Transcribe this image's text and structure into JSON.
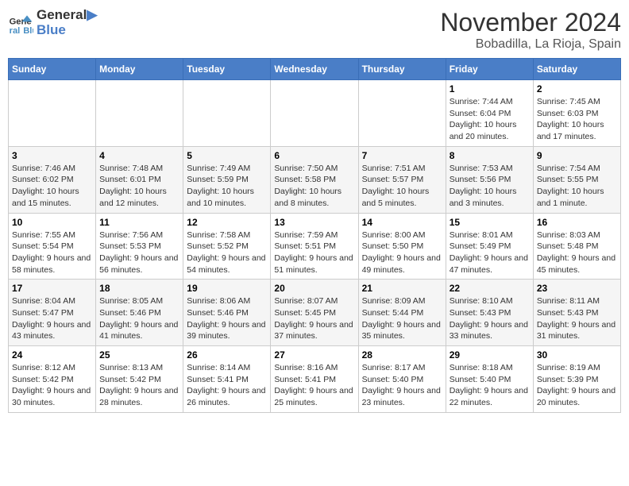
{
  "header": {
    "logo_line1": "General",
    "logo_line2": "Blue",
    "month_year": "November 2024",
    "location": "Bobadilla, La Rioja, Spain"
  },
  "days_of_week": [
    "Sunday",
    "Monday",
    "Tuesday",
    "Wednesday",
    "Thursday",
    "Friday",
    "Saturday"
  ],
  "weeks": [
    [
      {
        "day": "",
        "info": ""
      },
      {
        "day": "",
        "info": ""
      },
      {
        "day": "",
        "info": ""
      },
      {
        "day": "",
        "info": ""
      },
      {
        "day": "",
        "info": ""
      },
      {
        "day": "1",
        "info": "Sunrise: 7:44 AM\nSunset: 6:04 PM\nDaylight: 10 hours and 20 minutes."
      },
      {
        "day": "2",
        "info": "Sunrise: 7:45 AM\nSunset: 6:03 PM\nDaylight: 10 hours and 17 minutes."
      }
    ],
    [
      {
        "day": "3",
        "info": "Sunrise: 7:46 AM\nSunset: 6:02 PM\nDaylight: 10 hours and 15 minutes."
      },
      {
        "day": "4",
        "info": "Sunrise: 7:48 AM\nSunset: 6:01 PM\nDaylight: 10 hours and 12 minutes."
      },
      {
        "day": "5",
        "info": "Sunrise: 7:49 AM\nSunset: 5:59 PM\nDaylight: 10 hours and 10 minutes."
      },
      {
        "day": "6",
        "info": "Sunrise: 7:50 AM\nSunset: 5:58 PM\nDaylight: 10 hours and 8 minutes."
      },
      {
        "day": "7",
        "info": "Sunrise: 7:51 AM\nSunset: 5:57 PM\nDaylight: 10 hours and 5 minutes."
      },
      {
        "day": "8",
        "info": "Sunrise: 7:53 AM\nSunset: 5:56 PM\nDaylight: 10 hours and 3 minutes."
      },
      {
        "day": "9",
        "info": "Sunrise: 7:54 AM\nSunset: 5:55 PM\nDaylight: 10 hours and 1 minute."
      }
    ],
    [
      {
        "day": "10",
        "info": "Sunrise: 7:55 AM\nSunset: 5:54 PM\nDaylight: 9 hours and 58 minutes."
      },
      {
        "day": "11",
        "info": "Sunrise: 7:56 AM\nSunset: 5:53 PM\nDaylight: 9 hours and 56 minutes."
      },
      {
        "day": "12",
        "info": "Sunrise: 7:58 AM\nSunset: 5:52 PM\nDaylight: 9 hours and 54 minutes."
      },
      {
        "day": "13",
        "info": "Sunrise: 7:59 AM\nSunset: 5:51 PM\nDaylight: 9 hours and 51 minutes."
      },
      {
        "day": "14",
        "info": "Sunrise: 8:00 AM\nSunset: 5:50 PM\nDaylight: 9 hours and 49 minutes."
      },
      {
        "day": "15",
        "info": "Sunrise: 8:01 AM\nSunset: 5:49 PM\nDaylight: 9 hours and 47 minutes."
      },
      {
        "day": "16",
        "info": "Sunrise: 8:03 AM\nSunset: 5:48 PM\nDaylight: 9 hours and 45 minutes."
      }
    ],
    [
      {
        "day": "17",
        "info": "Sunrise: 8:04 AM\nSunset: 5:47 PM\nDaylight: 9 hours and 43 minutes."
      },
      {
        "day": "18",
        "info": "Sunrise: 8:05 AM\nSunset: 5:46 PM\nDaylight: 9 hours and 41 minutes."
      },
      {
        "day": "19",
        "info": "Sunrise: 8:06 AM\nSunset: 5:46 PM\nDaylight: 9 hours and 39 minutes."
      },
      {
        "day": "20",
        "info": "Sunrise: 8:07 AM\nSunset: 5:45 PM\nDaylight: 9 hours and 37 minutes."
      },
      {
        "day": "21",
        "info": "Sunrise: 8:09 AM\nSunset: 5:44 PM\nDaylight: 9 hours and 35 minutes."
      },
      {
        "day": "22",
        "info": "Sunrise: 8:10 AM\nSunset: 5:43 PM\nDaylight: 9 hours and 33 minutes."
      },
      {
        "day": "23",
        "info": "Sunrise: 8:11 AM\nSunset: 5:43 PM\nDaylight: 9 hours and 31 minutes."
      }
    ],
    [
      {
        "day": "24",
        "info": "Sunrise: 8:12 AM\nSunset: 5:42 PM\nDaylight: 9 hours and 30 minutes."
      },
      {
        "day": "25",
        "info": "Sunrise: 8:13 AM\nSunset: 5:42 PM\nDaylight: 9 hours and 28 minutes."
      },
      {
        "day": "26",
        "info": "Sunrise: 8:14 AM\nSunset: 5:41 PM\nDaylight: 9 hours and 26 minutes."
      },
      {
        "day": "27",
        "info": "Sunrise: 8:16 AM\nSunset: 5:41 PM\nDaylight: 9 hours and 25 minutes."
      },
      {
        "day": "28",
        "info": "Sunrise: 8:17 AM\nSunset: 5:40 PM\nDaylight: 9 hours and 23 minutes."
      },
      {
        "day": "29",
        "info": "Sunrise: 8:18 AM\nSunset: 5:40 PM\nDaylight: 9 hours and 22 minutes."
      },
      {
        "day": "30",
        "info": "Sunrise: 8:19 AM\nSunset: 5:39 PM\nDaylight: 9 hours and 20 minutes."
      }
    ]
  ]
}
